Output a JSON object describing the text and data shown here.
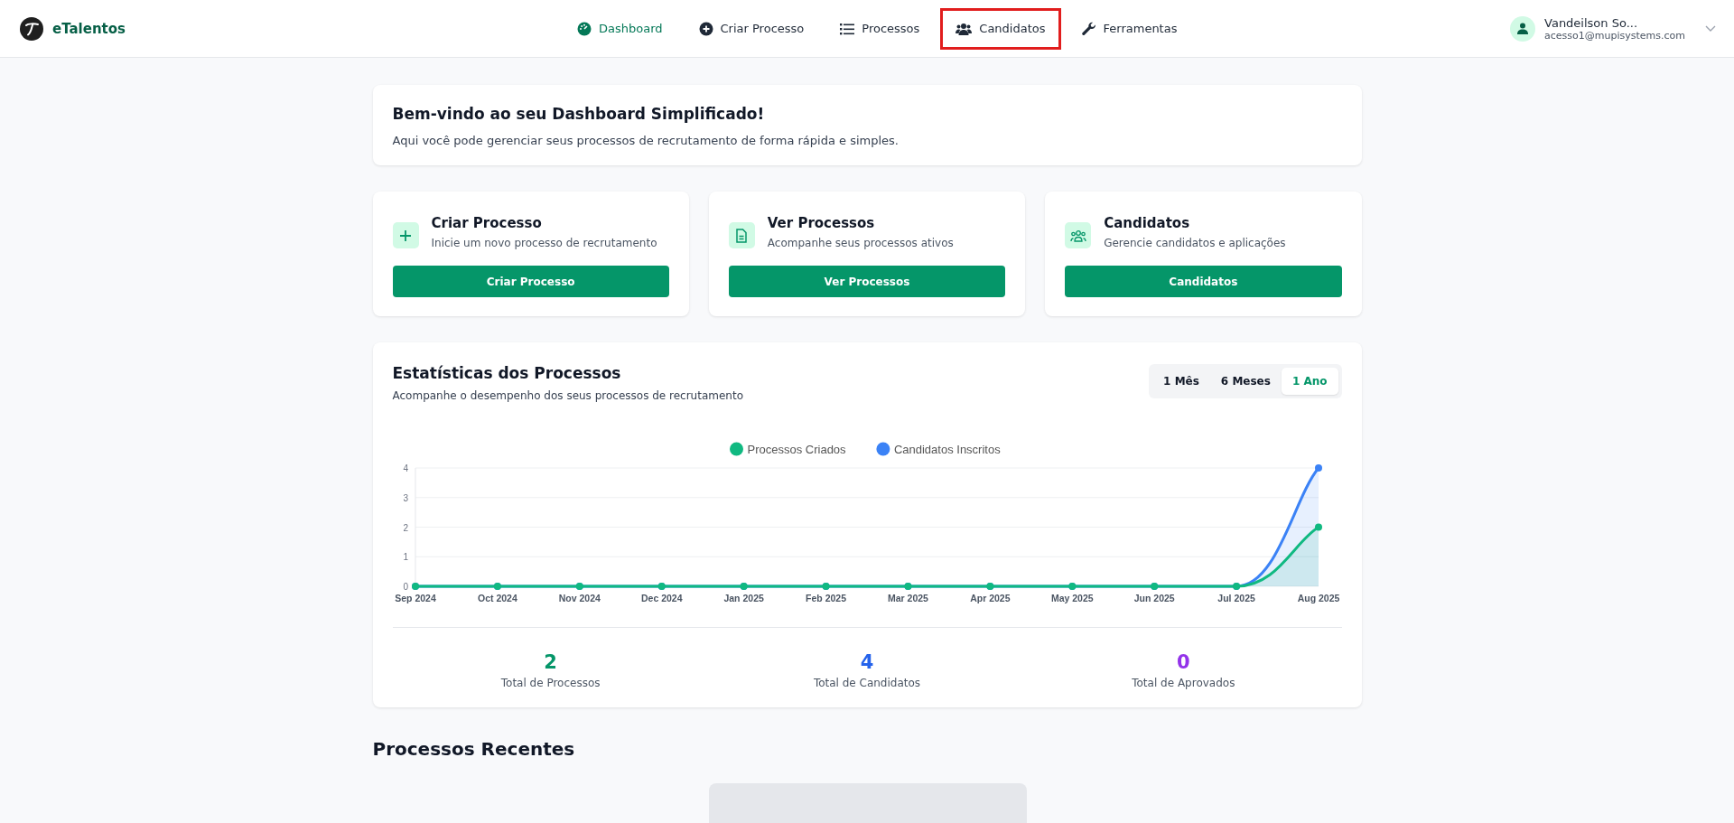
{
  "header": {
    "brand": "eTalentos",
    "nav": [
      {
        "label": "Dashboard",
        "kind": "gauge",
        "selected": true,
        "highlighted": false
      },
      {
        "label": "Criar Processo",
        "kind": "create",
        "selected": false,
        "highlighted": false
      },
      {
        "label": "Processos",
        "kind": "list",
        "selected": false,
        "highlighted": false
      },
      {
        "label": "Candidatos",
        "kind": "people",
        "selected": false,
        "highlighted": true
      },
      {
        "label": "Ferramentas",
        "kind": "tools",
        "selected": false,
        "highlighted": false
      }
    ],
    "user": {
      "name": "Vandeilson So...",
      "email": "acesso1@mupisystems.com"
    }
  },
  "welcome": {
    "title": "Bem-vindo ao seu Dashboard Simplificado!",
    "text": "Aqui você pode gerenciar seus processos de recrutamento de forma rápida e simples."
  },
  "actions": [
    {
      "kind": "create",
      "title": "Criar Processo",
      "text": "Inicie um novo processo de recrutamento",
      "button": "Criar Processo"
    },
    {
      "kind": "view",
      "title": "Ver Processos",
      "text": "Acompanhe seus processos ativos",
      "button": "Ver Processos"
    },
    {
      "kind": "people",
      "title": "Candidatos",
      "text": "Gerencie candidatos e aplicações",
      "button": "Candidatos"
    }
  ],
  "stats": {
    "title": "Estatísticas dos Processos",
    "subtitle": "Acompanhe o desempenho dos seus processos de recrutamento",
    "ranges": [
      {
        "label": "1 Mês",
        "selected": false
      },
      {
        "label": "6 Meses",
        "selected": false
      },
      {
        "label": "1 Ano",
        "selected": true
      }
    ],
    "chart_data": {
      "type": "area",
      "categories": [
        "Sep 2024",
        "Oct 2024",
        "Nov 2024",
        "Dec 2024",
        "Jan 2025",
        "Feb 2025",
        "Mar 2025",
        "Apr 2025",
        "May 2025",
        "Jun 2025",
        "Jul 2025",
        "Aug 2025"
      ],
      "series": [
        {
          "name": "Processos Criados",
          "color": "#10b981",
          "values": [
            0,
            0,
            0,
            0,
            0,
            0,
            0,
            0,
            0,
            0,
            0,
            2
          ]
        },
        {
          "name": "Candidatos Inscritos",
          "color": "#3b82f6",
          "values": [
            0,
            0,
            0,
            0,
            0,
            0,
            0,
            0,
            0,
            0,
            0,
            4
          ]
        }
      ],
      "ylim": [
        0,
        4
      ],
      "yticks": [
        0,
        1,
        2,
        3,
        4
      ],
      "grid": true,
      "legend": "top"
    },
    "totals": [
      {
        "value": "2",
        "label": "Total de Processos",
        "color": "#059669"
      },
      {
        "value": "4",
        "label": "Total de Candidatos",
        "color": "#2563eb"
      },
      {
        "value": "0",
        "label": "Total de Aprovados",
        "color": "#9333ea"
      }
    ]
  },
  "recent": {
    "title": "Processos Recentes"
  }
}
